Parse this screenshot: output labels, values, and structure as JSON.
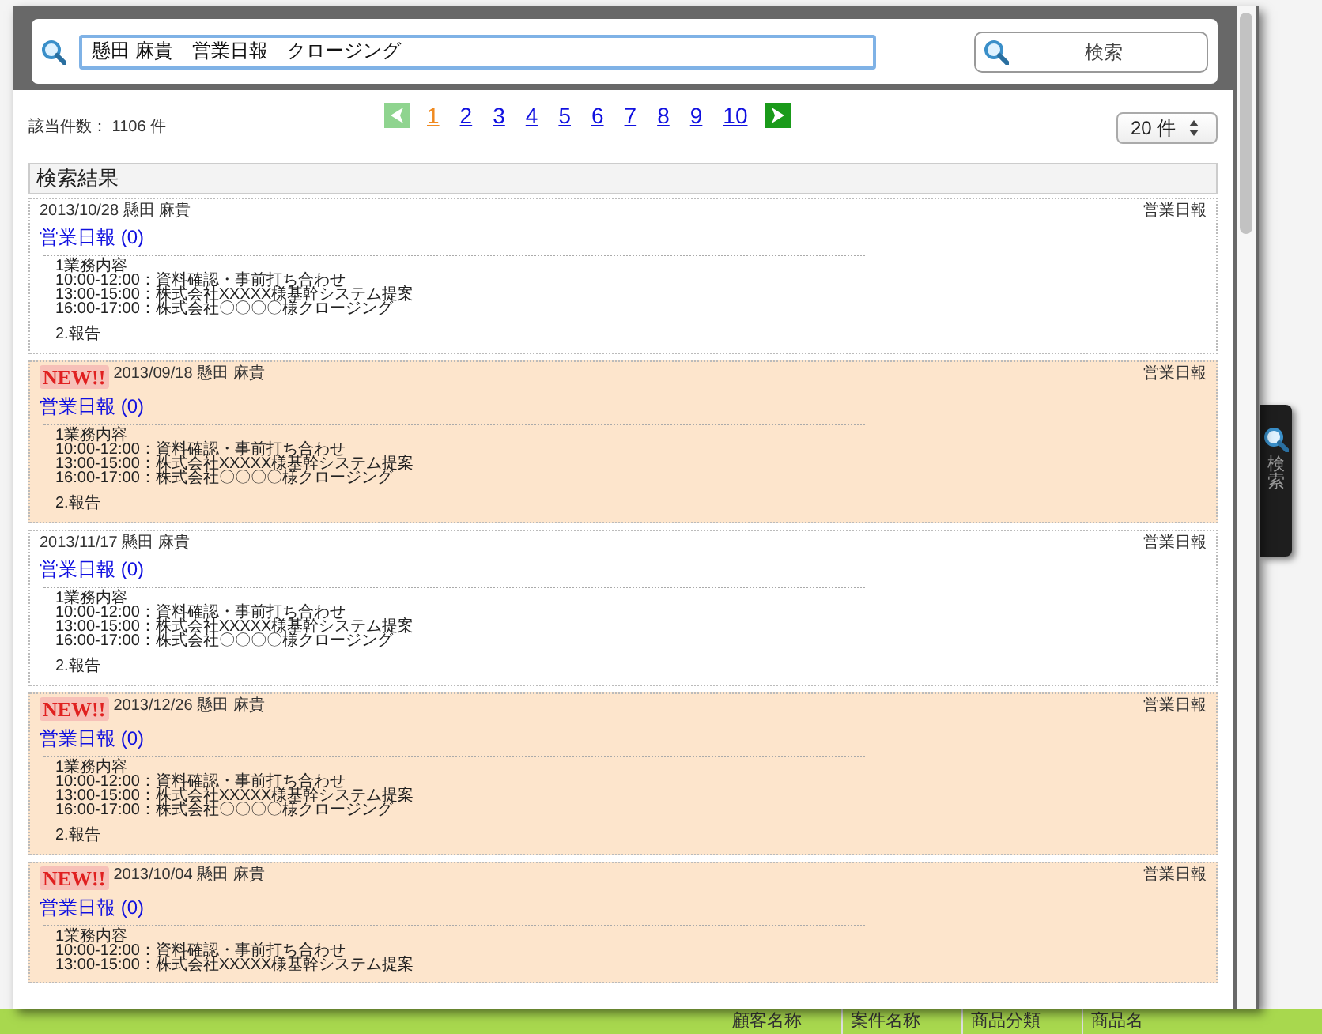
{
  "search": {
    "query": "懸田 麻貴　営業日報　クロージング",
    "button": "検索"
  },
  "results_header": {
    "count_label": "該当件数：",
    "count": "1106 件",
    "page_size": "20 件"
  },
  "pagination": {
    "prev": {
      "disabled": true
    },
    "next": {
      "disabled": false
    },
    "pages": [
      {
        "label": "1",
        "selected": true
      },
      {
        "label": "2",
        "selected": false
      },
      {
        "label": "3",
        "selected": false
      },
      {
        "label": "4",
        "selected": false
      },
      {
        "label": "5",
        "selected": false
      },
      {
        "label": "6",
        "selected": false
      },
      {
        "label": "7",
        "selected": false
      },
      {
        "label": "8",
        "selected": false
      },
      {
        "label": "9",
        "selected": false
      },
      {
        "label": "10",
        "selected": false
      }
    ]
  },
  "section_title": "検索結果",
  "entries": [
    {
      "new": false,
      "date": "2013/10/28",
      "author": "懸田 麻貴",
      "category": "営業日報",
      "title": "営業日報",
      "count": "(0)",
      "body": [
        "1業務内容",
        "10:00-12:00：資料確認・事前打ち合わせ",
        "13:00-15:00：株式会社XXXXX様基幹システム提案",
        "16:00-17:00：株式会社〇〇〇〇様クロージング"
      ],
      "report": "2.報告"
    },
    {
      "new": true,
      "badge": "NEW!!",
      "date": "2013/09/18",
      "author": "懸田 麻貴",
      "category": "営業日報",
      "title": "営業日報",
      "count": "(0)",
      "body": [
        "1業務内容",
        "10:00-12:00：資料確認・事前打ち合わせ",
        "13:00-15:00：株式会社XXXXX様基幹システム提案",
        "16:00-17:00：株式会社〇〇〇〇様クロージング"
      ],
      "report": "2.報告"
    },
    {
      "new": false,
      "date": "2013/11/17",
      "author": "懸田 麻貴",
      "category": "営業日報",
      "title": "営業日報",
      "count": "(0)",
      "body": [
        "1業務内容",
        "10:00-12:00：資料確認・事前打ち合わせ",
        "13:00-15:00：株式会社XXXXX様基幹システム提案",
        "16:00-17:00：株式会社〇〇〇〇様クロージング"
      ],
      "report": "2.報告"
    },
    {
      "new": true,
      "badge": "NEW!!",
      "date": "2013/12/26",
      "author": "懸田 麻貴",
      "category": "営業日報",
      "title": "営業日報",
      "count": "(0)",
      "body": [
        "1業務内容",
        "10:00-12:00：資料確認・事前打ち合わせ",
        "13:00-15:00：株式会社XXXXX様基幹システム提案",
        "16:00-17:00：株式会社〇〇〇〇様クロージング"
      ],
      "report": "2.報告"
    },
    {
      "new": true,
      "badge": "NEW!!",
      "date": "2013/10/04",
      "author": "懸田 麻貴",
      "category": "営業日報",
      "title": "営業日報",
      "count": "(0)",
      "body": [
        "1業務内容",
        "10:00-12:00：資料確認・事前打ち合わせ",
        "13:00-15:00：株式会社XXXXX様基幹システム提案"
      ]
    }
  ],
  "side_tab": {
    "label": "検索"
  },
  "table_header": {
    "columns": [
      "顧客名称",
      "案件名称",
      "商品分類",
      "商品名"
    ]
  }
}
